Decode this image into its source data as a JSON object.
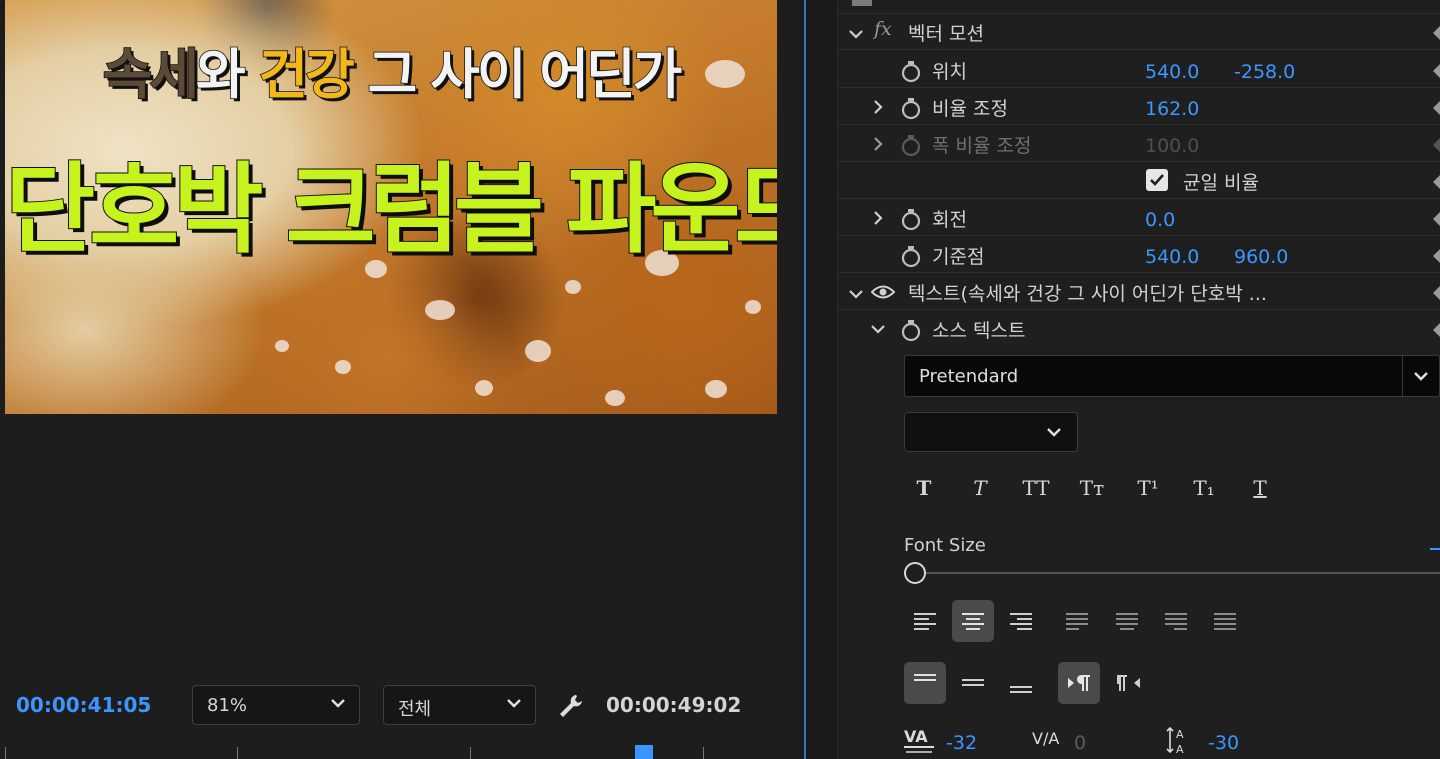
{
  "monitor": {
    "overlay": {
      "line1": [
        {
          "text": "속세",
          "style": "dark"
        },
        {
          "text": "와 ",
          "style": "white"
        },
        {
          "text": "건강",
          "style": "gold"
        },
        {
          "text": " 그 사이 어딘가",
          "style": "white"
        }
      ],
      "line2": "단호박 크럼블 파운드"
    },
    "current_timecode": "00:00:41:05",
    "zoom_select": "81%",
    "resolution_select": "전체",
    "wrench_icon": "wrench-icon",
    "duration_timecode": "00:00:49:02",
    "colors": {
      "timecode": "#3c96ff",
      "title_green": "#c6f21e",
      "title_gold": "#f2b81b"
    }
  },
  "effects": {
    "motion": {
      "fx_icon": "fx",
      "label": "벡터 모션",
      "position": {
        "label": "위치",
        "x": "540.0",
        "y": "-258.0"
      },
      "scale": {
        "label": "비율 조정",
        "value": "162.0"
      },
      "scale_width": {
        "label": "폭 비율 조정",
        "value": "100.0"
      },
      "uniform": {
        "label": "균일 비율",
        "checked": true
      },
      "rotation": {
        "label": "회전",
        "value": "0.0"
      },
      "anchor": {
        "label": "기준점",
        "x": "540.0",
        "y": "960.0"
      }
    },
    "text": {
      "label": "텍스트(속세와 건강 그 사이 어딘가 단호박 ...",
      "source": {
        "label": "소스 텍스트"
      },
      "font": "Pretendard",
      "font_style": "",
      "style_buttons": [
        "T",
        "T",
        "TT",
        "Tт",
        "T¹",
        "T₁",
        "T"
      ],
      "font_size": {
        "label": "Font Size",
        "level": 0
      },
      "kerning": "-32",
      "tracking": "0",
      "leading": "-30"
    }
  }
}
